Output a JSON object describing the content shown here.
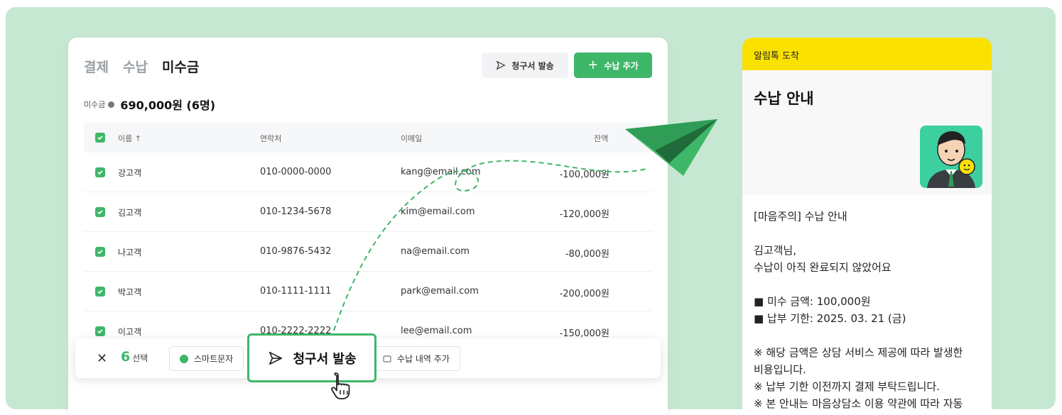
{
  "tabs": [
    "결제",
    "수납",
    "미수금"
  ],
  "header_buttons": {
    "send": "청구서 발송",
    "add": "수납 추가"
  },
  "summary": {
    "label": "미수금",
    "amount": "690,000원 (6명)"
  },
  "table": {
    "headers": [
      "이름 ↑",
      "연락처",
      "이메일",
      "잔액"
    ],
    "rows": [
      {
        "name": "강고객",
        "phone": "010-0000-0000",
        "email": "kang@email.com",
        "balance": "-100,000원"
      },
      {
        "name": "김고객",
        "phone": "010-1234-5678",
        "email": "kim@email.com",
        "balance": "-120,000원"
      },
      {
        "name": "나고객",
        "phone": "010-9876-5432",
        "email": "na@email.com",
        "balance": "-80,000원"
      },
      {
        "name": "박고객",
        "phone": "010-1111-1111",
        "email": "park@email.com",
        "balance": "-200,000원"
      },
      {
        "name": "이고객",
        "phone": "010-2222-2222",
        "email": "lee@email.com",
        "balance": "-150,000원"
      }
    ]
  },
  "action_bar": {
    "count": "6",
    "count_label": "선택",
    "sms": "스마트문자",
    "send": "청구서 발송",
    "history": "수납 내역 추가"
  },
  "phone": {
    "top": "알림톡 도착",
    "title": "수납 안내",
    "body": [
      "[마음주의] 수납 안내",
      "",
      "김고객님,",
      "수납이 아직 완료되지 않았어요",
      "",
      "■ 미수 금액: 100,000원",
      "■ 납부 기한: 2025. 03. 21 (금)",
      "",
      "※ 해당 금액은 상담 서비스 제공에 따라 발생한",
      "비용입니다.",
      "※ 납부 기한 이전까지 결제 부탁드립니다.",
      "※ 본 안내는 마음상담소 이용 약관에 따라 자동"
    ]
  },
  "colors": {
    "accent": "#3fb768",
    "background": "#c6e8d3",
    "kakao": "#fae100"
  }
}
